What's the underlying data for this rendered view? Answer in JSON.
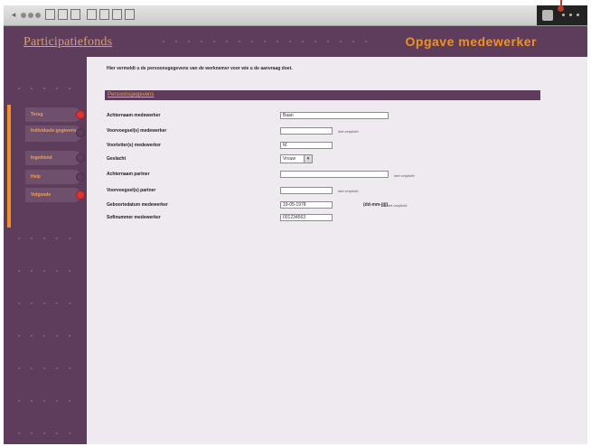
{
  "header": {
    "app_title": "Participatiefonds",
    "page_title": "Opgave medewerker"
  },
  "sidebar": {
    "items": [
      {
        "label": "Terug",
        "active": true
      },
      {
        "label": "Individuele gegevens"
      },
      {
        "label": "Ingediend"
      },
      {
        "label": "Help"
      },
      {
        "label": "Volgende",
        "active": true
      }
    ]
  },
  "main": {
    "intro": "Hier vermeldt u de persoonsgegevens van de werknemer voor wie u de aanvraag doet.",
    "section_title": "Persoonsgegevens",
    "fields": [
      {
        "label": "Achternaam medewerker",
        "value": "Baan"
      },
      {
        "label": "Voorvoegsel(s) medewerker",
        "value": "",
        "note": "niet verplicht"
      },
      {
        "label": "Voorletter(s) medewerker",
        "value": "M."
      },
      {
        "label": "Geslacht",
        "value": "Vrouw"
      },
      {
        "label": "Achternaam partner",
        "value": "",
        "note": "niet verplicht"
      },
      {
        "label": "Voorvoegsel(s) partner",
        "value": "",
        "note": "niet verplicht"
      },
      {
        "label": "Geboortedatum medewerker",
        "value": "19-05-1978",
        "calendar": "(dd-mm-jjjj)",
        "note": "niet verplicht"
      },
      {
        "label": "Sofinummer medewerker",
        "value": "001234563"
      }
    ]
  },
  "colors": {
    "frame": "#5e3d5c",
    "accent": "#f2921e",
    "content_bg": "#eeeaf0",
    "marker": "#e03232"
  },
  "icons": [
    "back-icon",
    "forward-icon",
    "stop-icon",
    "refresh-icon",
    "home-icon",
    "search-icon",
    "favorites-icon",
    "history-icon",
    "mail-icon",
    "print-icon",
    "lock-icon"
  ]
}
